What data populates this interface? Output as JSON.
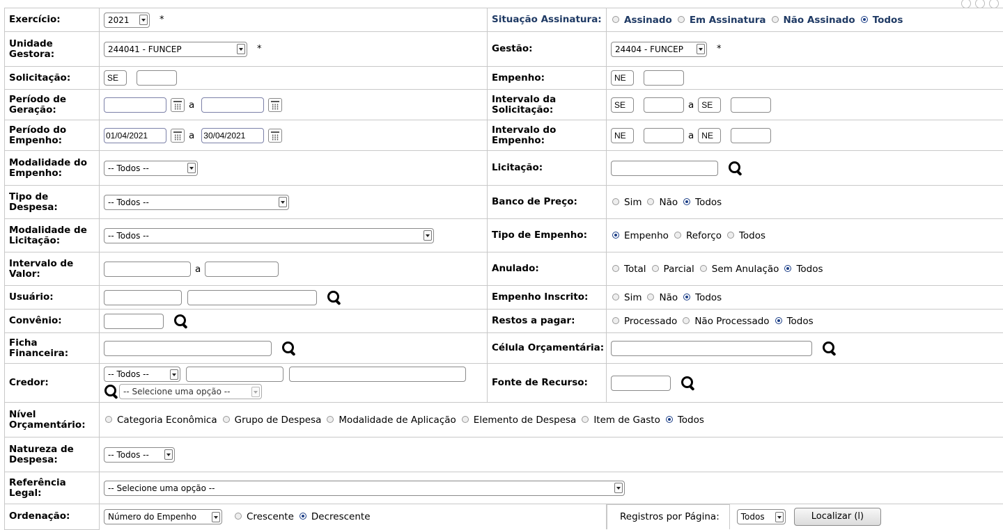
{
  "exercicio": {
    "label": "Exercício:",
    "value": "2021",
    "required": "*"
  },
  "situacao": {
    "label": "Situação Assinatura:",
    "options": [
      "Assinado",
      "Em Assinatura",
      "Não Assinado",
      "Todos"
    ],
    "selected": "Todos"
  },
  "unidade": {
    "label": "Unidade Gestora:",
    "value": "244041 - FUNCEP",
    "required": "*"
  },
  "gestao": {
    "label": "Gestão:",
    "value": "24404 - FUNCEP",
    "required": "*"
  },
  "solicitacao": {
    "label": "Solicitação:",
    "prefix": "SE",
    "value": ""
  },
  "empenho": {
    "label": "Empenho:",
    "prefix": "NE",
    "value": ""
  },
  "periodo_geracao": {
    "label": "Período de Geração:",
    "from": "",
    "to": "",
    "sep": "a"
  },
  "intervalo_solicitacao": {
    "label": "Intervalo da Solicitação:",
    "prefix1": "SE",
    "prefix2": "SE",
    "sep": "a"
  },
  "periodo_empenho": {
    "label": "Período do Empenho:",
    "from": "01/04/2021",
    "to": "30/04/2021",
    "sep": "a"
  },
  "intervalo_empenho": {
    "label": "Intervalo do Empenho:",
    "prefix1": "NE",
    "prefix2": "NE",
    "sep": "a"
  },
  "modalidade_empenho": {
    "label": "Modalidade do Empenho:",
    "value": "-- Todos --"
  },
  "licitacao": {
    "label": "Licitação:",
    "value": ""
  },
  "tipo_despesa": {
    "label": "Tipo de Despesa:",
    "value": "-- Todos --"
  },
  "banco_preco": {
    "label": "Banco de Preço:",
    "options": [
      "Sim",
      "Não",
      "Todos"
    ],
    "selected": "Todos"
  },
  "modalidade_licitacao": {
    "label": "Modalidade de Licitação:",
    "value": "-- Todos --"
  },
  "tipo_empenho": {
    "label": "Tipo de Empenho:",
    "options": [
      "Empenho",
      "Reforço",
      "Todos"
    ],
    "selected": "Empenho"
  },
  "intervalo_valor": {
    "label": "Intervalo de Valor:",
    "sep": "a"
  },
  "anulado": {
    "label": "Anulado:",
    "options": [
      "Total",
      "Parcial",
      "Sem Anulação",
      "Todos"
    ],
    "selected": "Todos"
  },
  "usuario": {
    "label": "Usuário:"
  },
  "empenho_inscrito": {
    "label": "Empenho Inscrito:",
    "options": [
      "Sim",
      "Não",
      "Todos"
    ],
    "selected": "Todos"
  },
  "convenio": {
    "label": "Convênio:"
  },
  "restos_pagar": {
    "label": "Restos a pagar:",
    "options": [
      "Processado",
      "Não Processado",
      "Todos"
    ],
    "selected": "Todos"
  },
  "ficha": {
    "label": "Ficha Financeira:"
  },
  "celula": {
    "label": "Célula Orçamentária:"
  },
  "credor": {
    "label": "Credor:",
    "type_value": "-- Todos --",
    "option_value": "-- Selecione uma opção --"
  },
  "fonte": {
    "label": "Fonte de Recurso:"
  },
  "nivel": {
    "label": "Nível Orçamentário:",
    "options": [
      "Categoria Econômica",
      "Grupo de Despesa",
      "Modalidade de Aplicação",
      "Elemento de Despesa",
      "Item de Gasto",
      "Todos"
    ],
    "selected": "Todos"
  },
  "natureza": {
    "label": "Natureza de Despesa:",
    "value": "-- Todos --"
  },
  "referencia": {
    "label": "Referência Legal:",
    "value": "-- Selecione uma opção --"
  },
  "ordenacao": {
    "label": "Ordenação:",
    "value": "Número do Empenho",
    "options": [
      "Crescente",
      "Decrescente"
    ],
    "selected": "Decrescente"
  },
  "registros": {
    "label": "Registros por Página:",
    "value": "Todos"
  },
  "localizar": {
    "label": "Localizar (l)"
  },
  "colors": {
    "label_blue": "#1f3a64",
    "radio_selected": "#1a3d86",
    "border": "#c8c8c8"
  }
}
